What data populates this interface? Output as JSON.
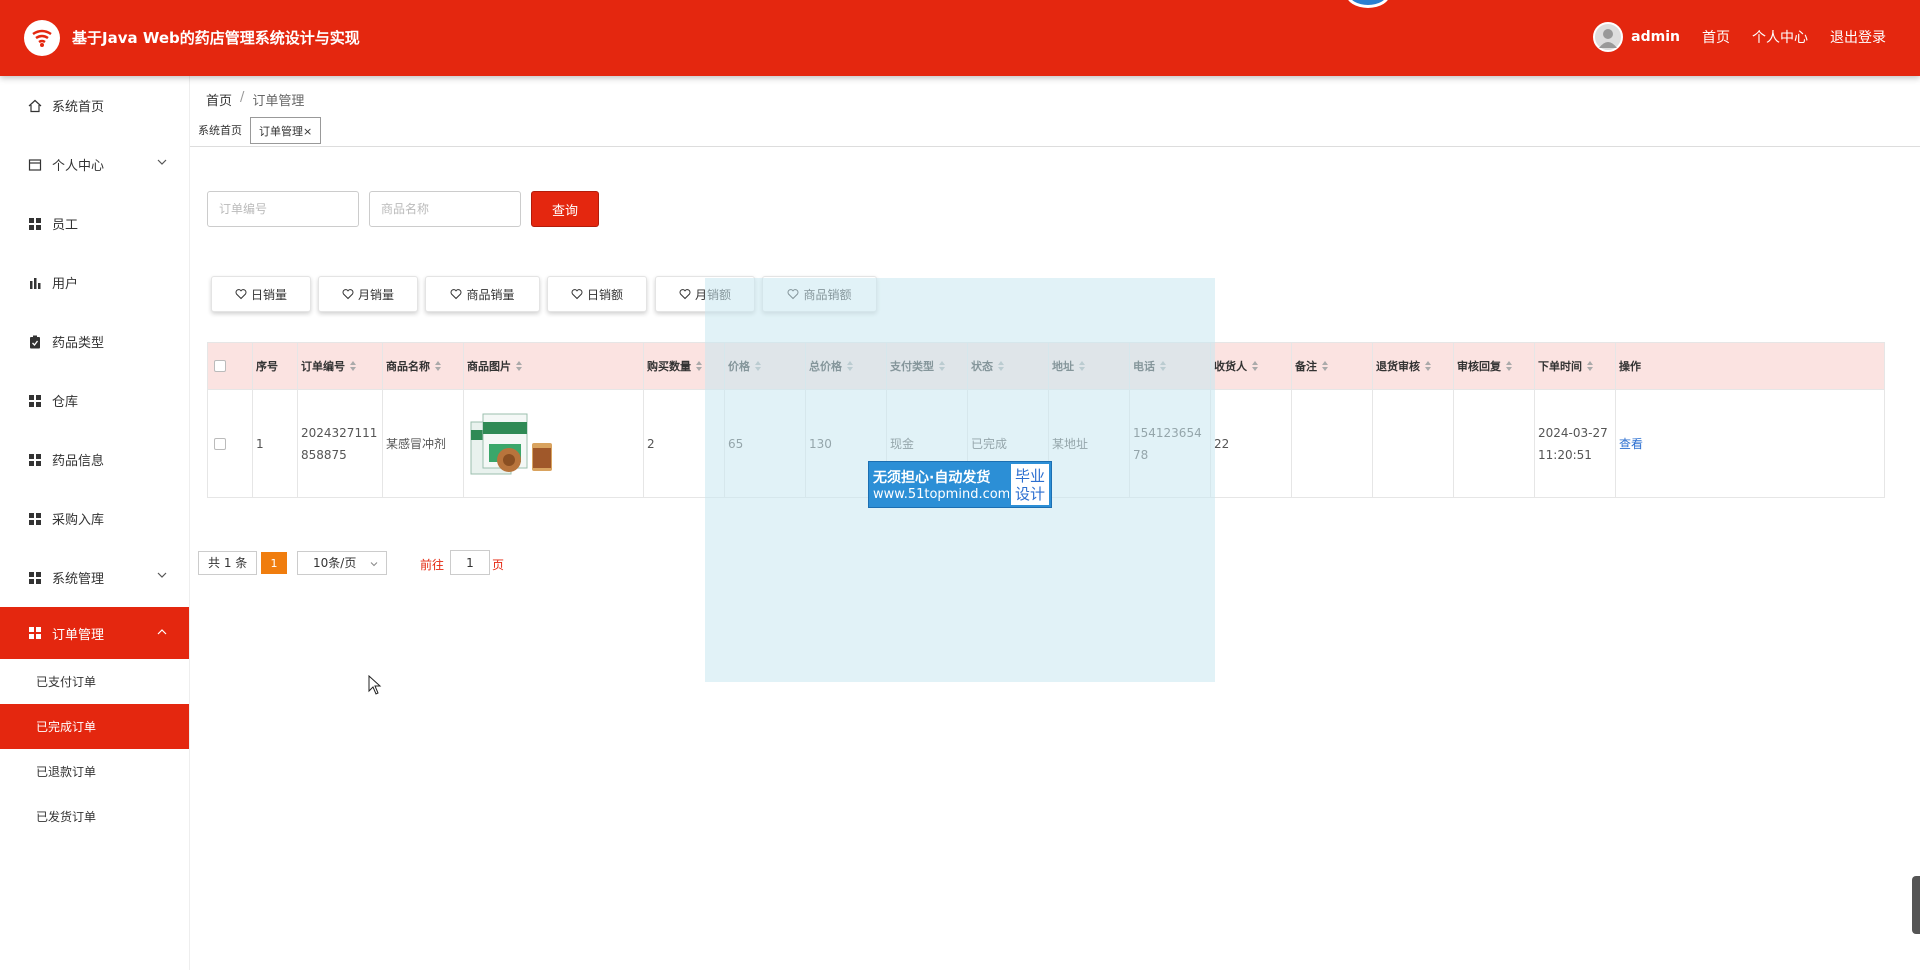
{
  "header": {
    "title": "基于Java Web的药店管理系统设计与实现",
    "username": "admin",
    "links": [
      "首页",
      "个人中心",
      "退出登录"
    ]
  },
  "sidebar": {
    "items": [
      {
        "label": "系统首页",
        "icon": "home-icon"
      },
      {
        "label": "个人中心",
        "icon": "profile-icon",
        "expandable": true
      },
      {
        "label": "员工",
        "icon": "grid-icon"
      },
      {
        "label": "用户",
        "icon": "bar-chart-icon"
      },
      {
        "label": "药品类型",
        "icon": "clipboard-icon"
      },
      {
        "label": "仓库",
        "icon": "grid-icon"
      },
      {
        "label": "药品信息",
        "icon": "grid-icon"
      },
      {
        "label": "采购入库",
        "icon": "grid-icon"
      },
      {
        "label": "系统管理",
        "icon": "grid-icon",
        "expandable": true
      },
      {
        "label": "订单管理",
        "icon": "grid-icon",
        "expandable": true,
        "active": true
      }
    ],
    "sub_items": [
      {
        "label": "已支付订单"
      },
      {
        "label": "已完成订单",
        "active": true
      },
      {
        "label": "已退款订单"
      },
      {
        "label": "已发货订单"
      }
    ]
  },
  "breadcrumb": {
    "home": "首页",
    "sep": "/",
    "current": "订单管理"
  },
  "tabs": [
    {
      "label": "系统首页"
    },
    {
      "label": "订单管理",
      "close": "×",
      "active": true
    }
  ],
  "search": {
    "order_no_placeholder": "订单编号",
    "product_placeholder": "商品名称",
    "button": "查询"
  },
  "stat_buttons": [
    "日销量",
    "月销量",
    "商品销量",
    "日销额",
    "月销额",
    "商品销额"
  ],
  "table": {
    "columns": [
      "序号",
      "订单编号",
      "商品名称",
      "商品图片",
      "购买数量",
      "价格",
      "总价格",
      "支付类型",
      "状态",
      "地址",
      "电话",
      "收货人",
      "备注",
      "退货审核",
      "审核回复",
      "下单时间",
      "操作"
    ],
    "rows": [
      {
        "index": "1",
        "order_no": "2024327111858875",
        "product": "某感冒冲剂",
        "quantity": "2",
        "price": "65",
        "total": "130",
        "pay_type": "现金",
        "status": "已完成",
        "address": "某地址",
        "phone": "15412365478",
        "receiver": "22",
        "remark": "",
        "return_review": "",
        "review_reply": "",
        "order_time": "2024-03-27 11:20:51",
        "action": "查看"
      }
    ]
  },
  "pagination": {
    "total": "共 1 条",
    "current_page": "1",
    "page_size": "10条/页",
    "goto_label": "前往",
    "goto_value": "1",
    "goto_unit": "页"
  },
  "watermark": {
    "line1": "无须担心·自动发货",
    "line2": "www.51topmind.com",
    "badge1": "毕业",
    "badge2": "设计"
  },
  "colors": {
    "primary": "#e4270f",
    "header_row": "#fbe3e1",
    "link": "#2c6fd0",
    "page_active": "#f07d0e"
  }
}
